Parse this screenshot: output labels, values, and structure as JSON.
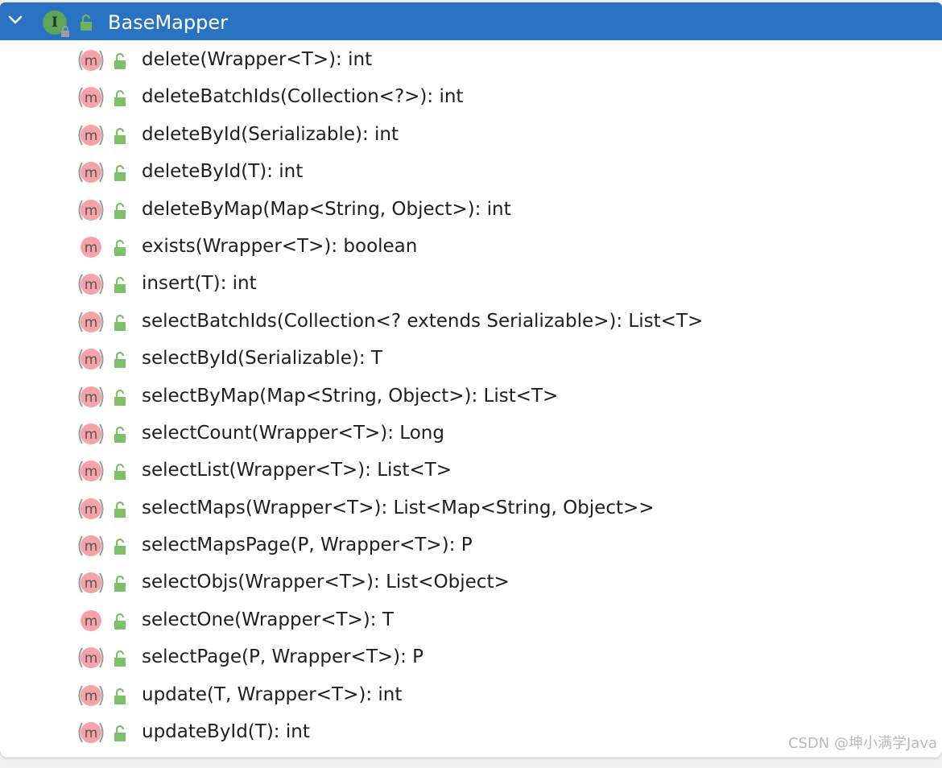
{
  "header": {
    "title": "BaseMapper",
    "interface_icon_letter": "I",
    "bg_color": "#2a73c2",
    "icons": [
      "chevron-down-icon",
      "interface-icon",
      "lock-open-icon"
    ]
  },
  "methods": [
    {
      "signature": "delete(Wrapper<T>): int",
      "style": "parenthesized"
    },
    {
      "signature": "deleteBatchIds(Collection<?>): int",
      "style": "parenthesized"
    },
    {
      "signature": "deleteById(Serializable): int",
      "style": "parenthesized"
    },
    {
      "signature": "deleteById(T): int",
      "style": "parenthesized"
    },
    {
      "signature": "deleteByMap(Map<String, Object>): int",
      "style": "parenthesized"
    },
    {
      "signature": "exists(Wrapper<T>): boolean",
      "style": "solid"
    },
    {
      "signature": "insert(T): int",
      "style": "parenthesized"
    },
    {
      "signature": "selectBatchIds(Collection<? extends Serializable>): List<T>",
      "style": "parenthesized"
    },
    {
      "signature": "selectById(Serializable): T",
      "style": "parenthesized"
    },
    {
      "signature": "selectByMap(Map<String, Object>): List<T>",
      "style": "parenthesized"
    },
    {
      "signature": "selectCount(Wrapper<T>): Long",
      "style": "parenthesized"
    },
    {
      "signature": "selectList(Wrapper<T>): List<T>",
      "style": "parenthesized"
    },
    {
      "signature": "selectMaps(Wrapper<T>): List<Map<String, Object>>",
      "style": "parenthesized"
    },
    {
      "signature": "selectMapsPage(P, Wrapper<T>): P",
      "style": "parenthesized"
    },
    {
      "signature": "selectObjs(Wrapper<T>): List<Object>",
      "style": "parenthesized"
    },
    {
      "signature": "selectOne(Wrapper<T>): T",
      "style": "solid"
    },
    {
      "signature": "selectPage(P, Wrapper<T>): P",
      "style": "parenthesized"
    },
    {
      "signature": "update(T, Wrapper<T>): int",
      "style": "parenthesized"
    },
    {
      "signature": "updateById(T): int",
      "style": "parenthesized"
    }
  ],
  "method_icon_letter": "m",
  "colors": {
    "method_icon_fill": "#f5a3a8",
    "method_icon_text": "#555555",
    "lock_green": "#7fbf6a"
  },
  "watermark": "CSDN @坤小满学Java"
}
